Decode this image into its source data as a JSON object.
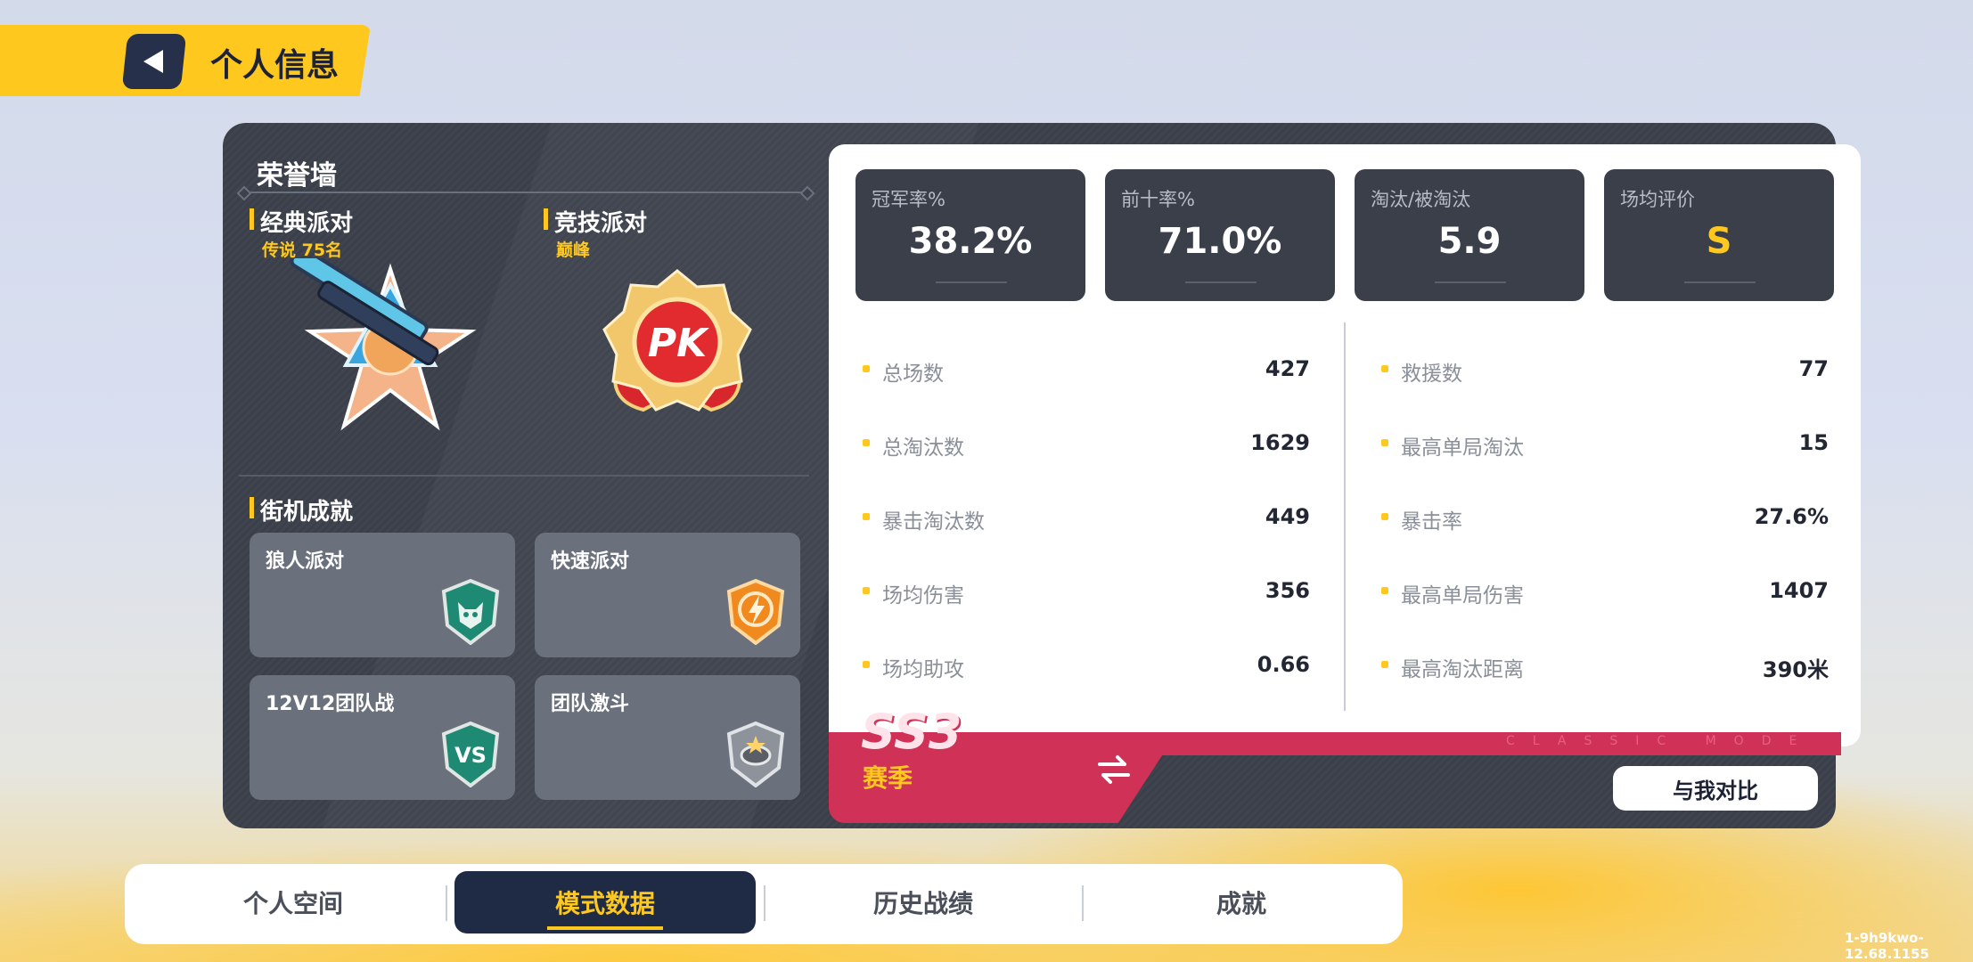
{
  "header": {
    "title": "个人信息"
  },
  "honor_wall": {
    "title": "荣誉墙",
    "classic": {
      "title": "经典派对",
      "rank": "传说 75名"
    },
    "competitive": {
      "title": "竞技派对",
      "rank": "巅峰",
      "badge_text": "PK"
    },
    "arcade": {
      "title": "街机成就",
      "cards": [
        {
          "label": "狼人派对",
          "icon": "wolf-badge-icon"
        },
        {
          "label": "快速派对",
          "icon": "lightning-badge-icon"
        },
        {
          "label": "12V12团队战",
          "icon": "vs-badge-icon"
        },
        {
          "label": "团队激斗",
          "icon": "team-brawl-badge-icon"
        }
      ]
    }
  },
  "summary": [
    {
      "label": "冠军率%",
      "value": "38.2%"
    },
    {
      "label": "前十率%",
      "value": "71.0%"
    },
    {
      "label": "淘汰/被淘汰",
      "value": "5.9"
    },
    {
      "label": "场均评价",
      "value": "S"
    }
  ],
  "stats_left": [
    {
      "label": "总场数",
      "value": "427"
    },
    {
      "label": "总淘汰数",
      "value": "1629"
    },
    {
      "label": "暴击淘汰数",
      "value": "449"
    },
    {
      "label": "场均伤害",
      "value": "356"
    },
    {
      "label": "场均助攻",
      "value": "0.66"
    }
  ],
  "stats_right": [
    {
      "label": "救援数",
      "value": "77"
    },
    {
      "label": "最高单局淘汰",
      "value": "15"
    },
    {
      "label": "暴击率",
      "value": "27.6%"
    },
    {
      "label": "最高单局伤害",
      "value": "1407"
    },
    {
      "label": "最高淘汰距离",
      "value": "390米"
    }
  ],
  "season": {
    "code": "SS3",
    "label": "赛季",
    "watermark": "CLASSIC MODE"
  },
  "compare_button": "与我对比",
  "tabs": [
    "个人空间",
    "模式数据",
    "历史战绩",
    "成就"
  ],
  "active_tab": "模式数据",
  "version": "1-9h9kwo-12.68.1155",
  "colors": {
    "accent": "#ffc81e",
    "panel": "#3a3f49",
    "season": "#d03157",
    "tab_active": "#1f2a45"
  }
}
